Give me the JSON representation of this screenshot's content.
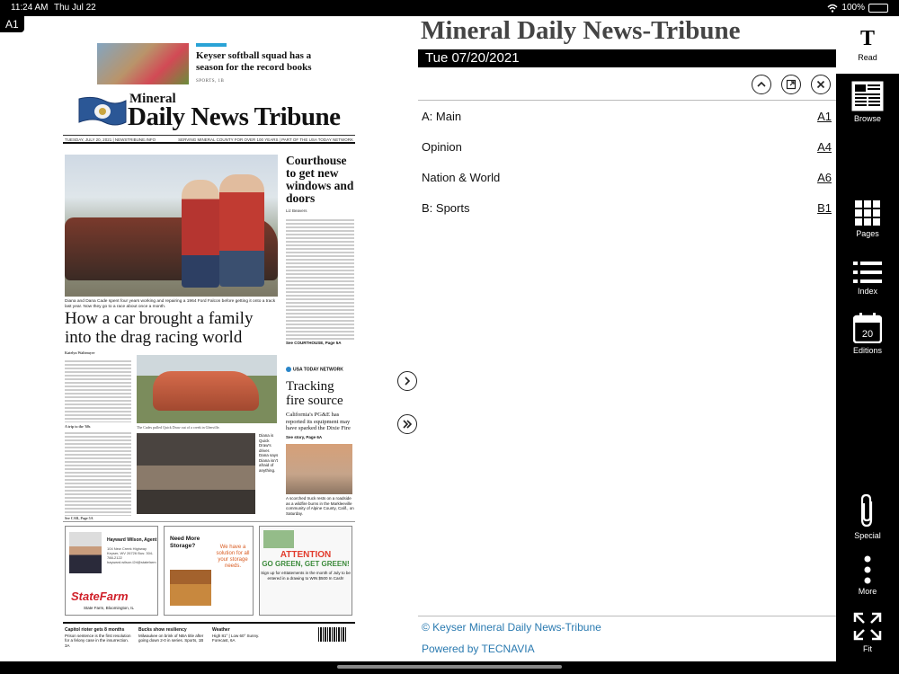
{
  "status": {
    "time": "11:24 AM",
    "date": "Thu Jul 22",
    "battery": "100%",
    "battery_level": 1.0
  },
  "page_label": "A1",
  "newspaper": {
    "teaser_title": "Keyser softball squad has a season for the record books",
    "teaser_section": "SPORTS, 1B",
    "masthead_small": "Mineral",
    "masthead_big": "Daily News Tribune",
    "dateline_left": "TUESDAY, JULY 20, 2021 | NEWSTRIBUNE.INFO",
    "dateline_right": "SERVING MINERAL COUNTY FOR OVER 100 YEARS | PART OF THE USA TODAY NETWORK",
    "lead_caption": "Diana and Dana Cade spent four years working and repairing a 1964 Ford Falcon before getting it onto a track last year. Now they go to a race about once a month.",
    "lead_headline": "How a car brought a family into the drag racing world",
    "lead_byline": "Katelyn Waltemyer",
    "lead_sub": "A trip to the '60s",
    "photo2_caption": "The Cades pulled Quick Draw out of a creek in Glenville.",
    "photo3_caption": "Diana is Quick Draw's driver. Dana says Diana isn't afraid of anything.",
    "lead_see": "See CAR, Page 5A",
    "right_headline": "Courthouse to get new windows and doors",
    "right_byline": "Liz Beavers",
    "right_see": "See COURTHOUSE, Page 5A",
    "usa_tag": "USA TODAY NETWORK",
    "fire_headline": "Tracking fire source",
    "fire_dek": "California's PG&E has reported its equipment may have sparked the Dixie Fire",
    "fire_see": "See story, Page 6A",
    "fire_caption": "A scorched truck rests on a roadside as a wildfire burns in the Markleeville community of Alpine County, Calif., on Saturday.",
    "ad1_agent": "Hayward Wilson, Agent",
    "ad1_address": "104 New Creek Highway Keyser, WV 26726 Bus: 304-788-2122 hayward.wilson.l2rl@statefarm.com",
    "ad1_brand": "StateFarm",
    "ad1_footer": "State Farm, Bloomington, IL",
    "ad2_title": "Need More Storage?",
    "ad2_slogan": "We have a solution for all your storage needs.",
    "ad3_line1": "ATTENTION",
    "ad3_line2": "GO GREEN, GET GREEN!",
    "ad3_line3": "Sign up for eStatements in the month of July to be entered in a drawing to WIN $500 In Cash!",
    "bottom1_title": "Capitol rioter gets 8 months",
    "bottom1_text": "Prison sentence is the first resolution for a felony case in the insurrection. 3A",
    "bottom2_title": "Bucks show resiliency",
    "bottom2_text": "Milwaukee on brink of NBA title after going down 2-0 in series. Sports, 1B",
    "bottom3_title": "Weather",
    "bottom3_text": "High 81° | Low 60° Sunny. Forecast, 6A"
  },
  "nav": {
    "next_page_icon": "chevron-right-icon",
    "last_page_icon": "double-chevron-right-icon"
  },
  "panel": {
    "title": "Mineral Daily News-Tribune",
    "date": "Tue 07/20/2021",
    "sections": [
      {
        "label": "A: Main",
        "page": "A1"
      },
      {
        "label": "Opinion",
        "page": "A4"
      },
      {
        "label": "Nation & World",
        "page": "A6"
      },
      {
        "label": "B: Sports",
        "page": "B1"
      }
    ],
    "copyright": "© Keyser Mineral Daily News-Tribune",
    "powered": "Powered by TECNAVIA"
  },
  "sidebar": {
    "read": "Read",
    "browse": "Browse",
    "pages": "Pages",
    "index": "Index",
    "editions": "Editions",
    "editions_count": "20",
    "special": "Special",
    "more": "More",
    "fit": "Fit"
  }
}
